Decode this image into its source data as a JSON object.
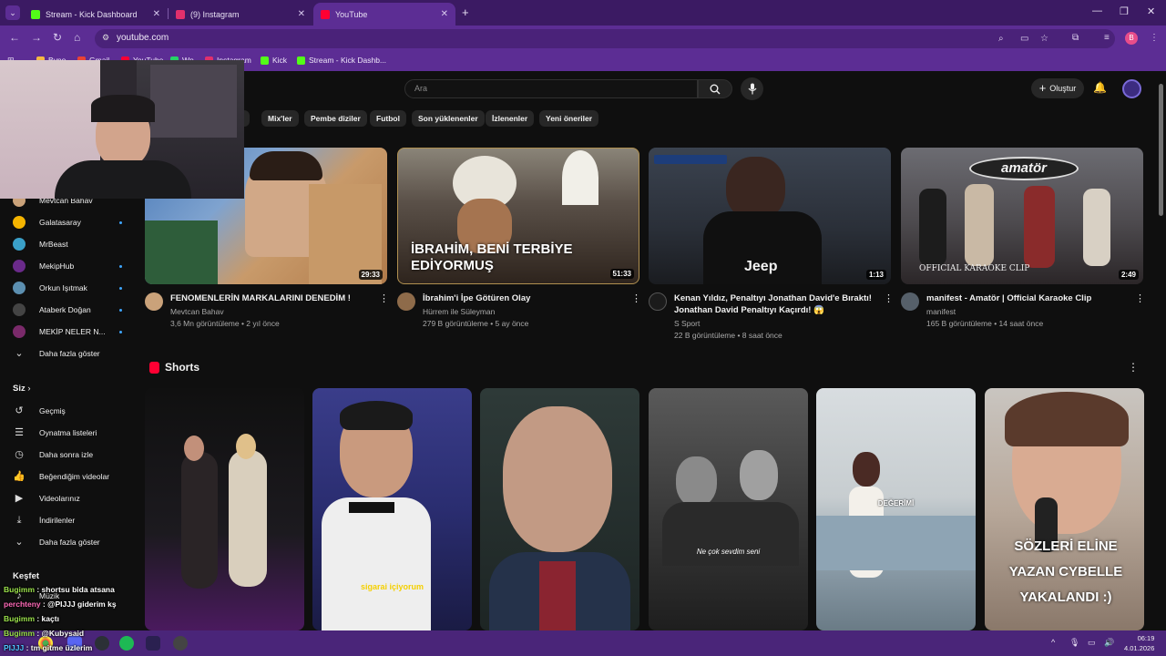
{
  "browser": {
    "tabs": [
      {
        "title": "Stream - Kick Dashboard",
        "fav_color": "#53fc18"
      },
      {
        "title": "(9) Instagram",
        "fav_color": "#e1306c"
      },
      {
        "title": "YouTube",
        "fav_color": "#ff0033"
      }
    ],
    "new_tab": "+",
    "url": "youtube.com",
    "bookmarks": [
      {
        "label": "Byno",
        "fav_color": "#f5b942"
      },
      {
        "label": "Gmail",
        "fav_color": "#ea4335"
      },
      {
        "label": "YouTube",
        "fav_color": "#ff0033"
      },
      {
        "label": "Wp",
        "fav_color": "#25d366"
      },
      {
        "label": "Instagram",
        "fav_color": "#e1306c"
      },
      {
        "label": "Kick",
        "fav_color": "#53fc18"
      },
      {
        "label": "Stream - Kick Dashb...",
        "fav_color": "#53fc18"
      }
    ],
    "profile_initial": "B"
  },
  "youtube": {
    "search_placeholder": "Ara",
    "create_label": "Oluştur",
    "chips": [
      "n",
      "Mix'ler",
      "Pembe diziler",
      "Futbol",
      "Son yüklenenler",
      "İzlenenler",
      "Yeni öneriler"
    ],
    "videos": [
      {
        "title": "FENOMENLERİN MARKALARINI DENEDİM !",
        "channel": "Mevtcan Bahav",
        "views": "3,6 Mn görüntüleme • 2 yıl önce",
        "duration": "29:33"
      },
      {
        "title": "İbrahim'i İpe Götüren Olay",
        "channel": "Hürrem ile Süleyman",
        "views": "279 B görüntüleme • 5 ay önce",
        "duration": "51:33",
        "overlay": "İBRAHİM, BENİ TERBİYE EDİYORMUŞ"
      },
      {
        "title": "Kenan Yıldız, Penaltıyı Jonathan David'e Bıraktı! Jonathan David Penaltıyı Kaçırdı! 😱",
        "channel": "S Sport",
        "views": "22 B görüntüleme • 8 saat önce",
        "duration": "1:13"
      },
      {
        "title": "manifest - Amatör | Official Karaoke Clip",
        "channel": "manifest",
        "views": "165 B görüntüleme • 14 saat önce",
        "duration": "2:49",
        "overlay": "amatör",
        "overlay2": "OFFICIAL KARAOKE CLIP"
      }
    ],
    "shorts_title": "Shorts",
    "shorts": [
      {
        "caption": ""
      },
      {
        "caption": "sigarai içiyorum"
      },
      {
        "caption": ""
      },
      {
        "caption": "Ne çok sevdim seni"
      },
      {
        "caption": "DEĞERİMİ"
      },
      {
        "caption": "SÖZLERİ ELİNE YAZAN CYBELLE YAKALANDI :)"
      }
    ]
  },
  "sidebar": {
    "subs": [
      {
        "label": "Mevtcan Bahav",
        "color": "#caa27a"
      },
      {
        "label": "Galatasaray",
        "color": "#f4b400",
        "live": true
      },
      {
        "label": "MrBeast",
        "color": "#3aa0c8"
      },
      {
        "label": "MekipHub",
        "color": "#6a2a8a",
        "live": true
      },
      {
        "label": "Orkun Işıtmak",
        "color": "#5c8fb0",
        "live": true
      },
      {
        "label": "Ataberk Doğan",
        "color": "#444",
        "live": true
      },
      {
        "label": "MEKİP NELER N...",
        "color": "#7a2a6a",
        "live": true
      }
    ],
    "show_more": "Daha fazla göster",
    "you_heading": "Siz",
    "you_items": [
      "Geçmiş",
      "Oynatma listeleri",
      "Daha sonra izle",
      "Beğendiğim videolar",
      "Videolarınız",
      "İndirilenler",
      "Daha fazla göster"
    ],
    "explore_heading": "Keşfet",
    "explore_item": "Müzik"
  },
  "chat": [
    {
      "user": "Bugimm",
      "msg": " : shortsu bida atsana"
    },
    {
      "user": "perchteny",
      "msg": " : @PIJJJ giderim kş"
    },
    {
      "user": "Bugimm",
      "msg": " : kaçtı"
    },
    {
      "user": "Bugimm",
      "msg": " : @Kubysaid"
    },
    {
      "user": "PIJJJ",
      "msg": " : tm gitme üzlerim"
    }
  ],
  "taskbar": {
    "time": "06:19",
    "date": "4.01.2026"
  }
}
